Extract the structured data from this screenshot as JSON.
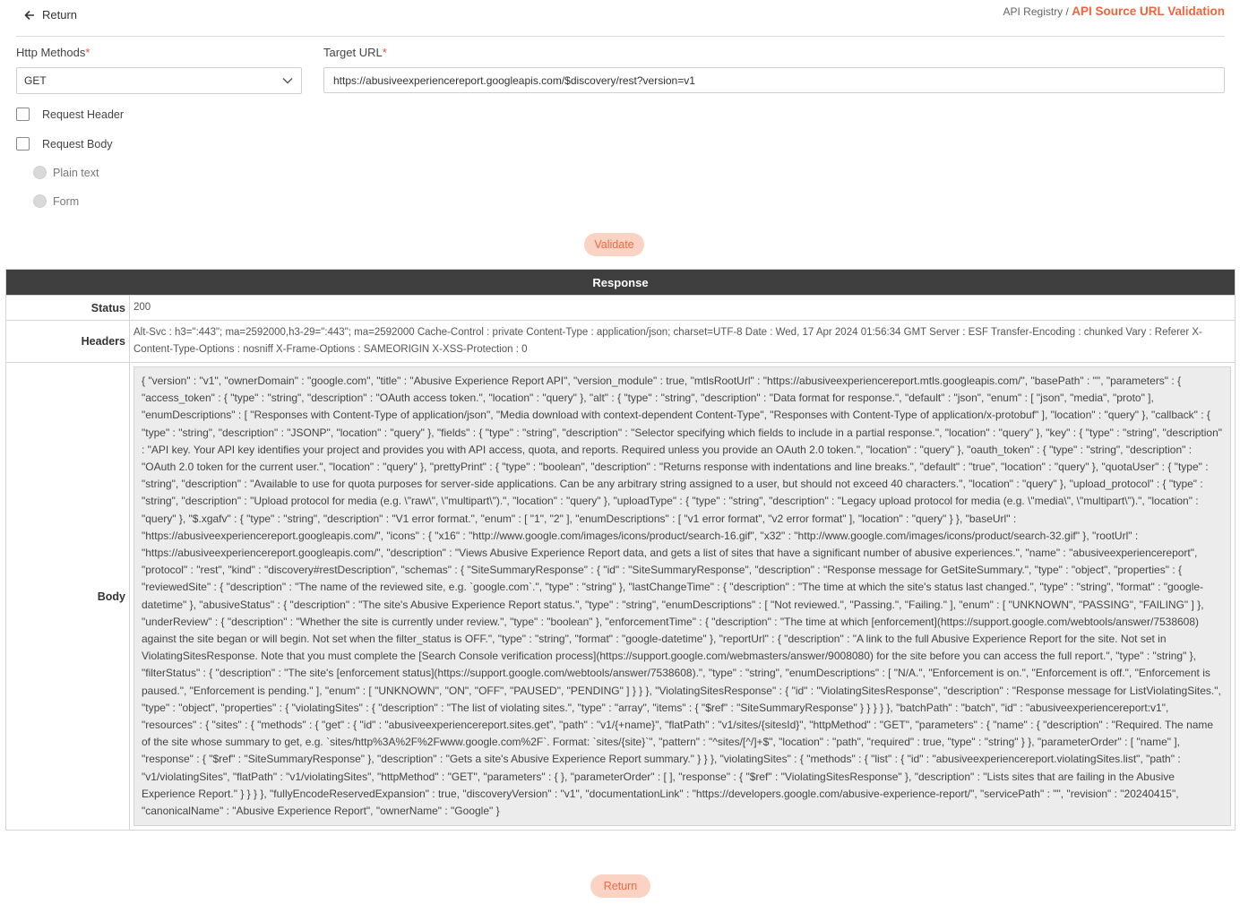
{
  "top": {
    "return_label": "Return",
    "breadcrumb_parent": "API Registry /",
    "breadcrumb_current": "API Source URL Validation"
  },
  "form": {
    "http_methods_label": "Http Methods",
    "http_method_value": "GET",
    "target_url_label": "Target URL",
    "target_url_value": "https://abusiveexperiencereport.googleapis.com/$discovery/rest?version=v1",
    "required_mark": "*",
    "request_header_label": "Request Header",
    "request_body_label": "Request Body",
    "plain_text_label": "Plain text",
    "form_label": "Form"
  },
  "buttons": {
    "validate": "Validate",
    "return": "Return"
  },
  "response": {
    "title": "Response",
    "status_label": "Status",
    "status_value": "200",
    "headers_label": "Headers",
    "headers_value": "Alt-Svc : h3=\":443\"; ma=2592000,h3-29=\":443\"; ma=2592000 Cache-Control : private Content-Type : application/json; charset=UTF-8 Date : Wed, 17 Apr 2024 01:56:34 GMT Server : ESF Transfer-Encoding : chunked Vary : Referer X-Content-Type-Options : nosniff X-Frame-Options : SAMEORIGIN X-XSS-Protection : 0",
    "body_label": "Body",
    "body_value": "{ \"version\" : \"v1\", \"ownerDomain\" : \"google.com\", \"title\" : \"Abusive Experience Report API\", \"version_module\" : true, \"mtlsRootUrl\" : \"https://abusiveexperiencereport.mtls.googleapis.com/\", \"basePath\" : \"\", \"parameters\" : { \"access_token\" : { \"type\" : \"string\", \"description\" : \"OAuth access token.\", \"location\" : \"query\" }, \"alt\" : { \"type\" : \"string\", \"description\" : \"Data format for response.\", \"default\" : \"json\", \"enum\" : [ \"json\", \"media\", \"proto\" ], \"enumDescriptions\" : [ \"Responses with Content-Type of application/json\", \"Media download with context-dependent Content-Type\", \"Responses with Content-Type of application/x-protobuf\" ], \"location\" : \"query\" }, \"callback\" : { \"type\" : \"string\", \"description\" : \"JSONP\", \"location\" : \"query\" }, \"fields\" : { \"type\" : \"string\", \"description\" : \"Selector specifying which fields to include in a partial response.\", \"location\" : \"query\" }, \"key\" : { \"type\" : \"string\", \"description\" : \"API key. Your API key identifies your project and provides you with API access, quota, and reports. Required unless you provide an OAuth 2.0 token.\", \"location\" : \"query\" }, \"oauth_token\" : { \"type\" : \"string\", \"description\" : \"OAuth 2.0 token for the current user.\", \"location\" : \"query\" }, \"prettyPrint\" : { \"type\" : \"boolean\", \"description\" : \"Returns response with indentations and line breaks.\", \"default\" : \"true\", \"location\" : \"query\" }, \"quotaUser\" : { \"type\" : \"string\", \"description\" : \"Available to use for quota purposes for server-side applications. Can be any arbitrary string assigned to a user, but should not exceed 40 characters.\", \"location\" : \"query\" }, \"upload_protocol\" : { \"type\" : \"string\", \"description\" : \"Upload protocol for media (e.g. \\\"raw\\\", \\\"multipart\\\").\", \"location\" : \"query\" }, \"uploadType\" : { \"type\" : \"string\", \"description\" : \"Legacy upload protocol for media (e.g. \\\"media\\\", \\\"multipart\\\").\", \"location\" : \"query\" }, \"$.xgafv\" : { \"type\" : \"string\", \"description\" : \"V1 error format.\", \"enum\" : [ \"1\", \"2\" ], \"enumDescriptions\" : [ \"v1 error format\", \"v2 error format\" ], \"location\" : \"query\" } }, \"baseUrl\" : \"https://abusiveexperiencereport.googleapis.com/\", \"icons\" : { \"x16\" : \"http://www.google.com/images/icons/product/search-16.gif\", \"x32\" : \"http://www.google.com/images/icons/product/search-32.gif\" }, \"rootUrl\" : \"https://abusiveexperiencereport.googleapis.com/\", \"description\" : \"Views Abusive Experience Report data, and gets a list of sites that have a significant number of abusive experiences.\", \"name\" : \"abusiveexperiencereport\", \"protocol\" : \"rest\", \"kind\" : \"discovery#restDescription\", \"schemas\" : { \"SiteSummaryResponse\" : { \"id\" : \"SiteSummaryResponse\", \"description\" : \"Response message for GetSiteSummary.\", \"type\" : \"object\", \"properties\" : { \"reviewedSite\" : { \"description\" : \"The name of the reviewed site, e.g. `google.com`.\", \"type\" : \"string\" }, \"lastChangeTime\" : { \"description\" : \"The time at which the site's status last changed.\", \"type\" : \"string\", \"format\" : \"google-datetime\" }, \"abusiveStatus\" : { \"description\" : \"The site's Abusive Experience Report status.\", \"type\" : \"string\", \"enumDescriptions\" : [ \"Not reviewed.\", \"Passing.\", \"Failing.\" ], \"enum\" : [ \"UNKNOWN\", \"PASSING\", \"FAILING\" ] }, \"underReview\" : { \"description\" : \"Whether the site is currently under review.\", \"type\" : \"boolean\" }, \"enforcementTime\" : { \"description\" : \"The time at which [enforcement](https://support.google.com/webtools/answer/7538608) against the site began or will begin. Not set when the filter_status is OFF.\", \"type\" : \"string\", \"format\" : \"google-datetime\" }, \"reportUrl\" : { \"description\" : \"A link to the full Abusive Experience Report for the site. Not set in ViolatingSitesResponse. Note that you must complete the [Search Console verification process](https://support.google.com/webmasters/answer/9008080) for the site before you can access the full report.\", \"type\" : \"string\" }, \"filterStatus\" : { \"description\" : \"The site's [enforcement status](https://support.google.com/webtools/answer/7538608).\", \"type\" : \"string\", \"enumDescriptions\" : [ \"N/A.\", \"Enforcement is on.\", \"Enforcement is off.\", \"Enforcement is paused.\", \"Enforcement is pending.\" ], \"enum\" : [ \"UNKNOWN\", \"ON\", \"OFF\", \"PAUSED\", \"PENDING\" ] } } }, \"ViolatingSitesResponse\" : { \"id\" : \"ViolatingSitesResponse\", \"description\" : \"Response message for ListViolatingSites.\", \"type\" : \"object\", \"properties\" : { \"violatingSites\" : { \"description\" : \"The list of violating sites.\", \"type\" : \"array\", \"items\" : { \"$ref\" : \"SiteSummaryResponse\" } } } } }, \"batchPath\" : \"batch\", \"id\" : \"abusiveexperiencereport:v1\", \"resources\" : { \"sites\" : { \"methods\" : { \"get\" : { \"id\" : \"abusiveexperiencereport.sites.get\", \"path\" : \"v1/{+name}\", \"flatPath\" : \"v1/sites/{sitesId}\", \"httpMethod\" : \"GET\", \"parameters\" : { \"name\" : { \"description\" : \"Required. The name of the site whose summary to get, e.g. `sites/http%3A%2F%2Fwww.google.com%2F`. Format: `sites/{site}`\", \"pattern\" : \"^sites/[^/]+$\", \"location\" : \"path\", \"required\" : true, \"type\" : \"string\" } }, \"parameterOrder\" : [ \"name\" ], \"response\" : { \"$ref\" : \"SiteSummaryResponse\" }, \"description\" : \"Gets a site's Abusive Experience Report summary.\" } } }, \"violatingSites\" : { \"methods\" : { \"list\" : { \"id\" : \"abusiveexperiencereport.violatingSites.list\", \"path\" : \"v1/violatingSites\", \"flatPath\" : \"v1/violatingSites\", \"httpMethod\" : \"GET\", \"parameters\" : { }, \"parameterOrder\" : [ ], \"response\" : { \"$ref\" : \"ViolatingSitesResponse\" }, \"description\" : \"Lists sites that are failing in the Abusive Experience Report.\" } } } }, \"fullyEncodeReservedExpansion\" : true, \"discoveryVersion\" : \"v1\", \"documentationLink\" : \"https://developers.google.com/abusive-experience-report/\", \"servicePath\" : \"\", \"revision\" : \"20240415\", \"canonicalName\" : \"Abusive Experience Report\", \"ownerName\" : \"Google\" }"
  },
  "icons": {
    "return": "arrow-left-icon",
    "select": "chevron-down-icon"
  },
  "colors": {
    "accent": "#f0643c",
    "button_bg": "#fbd3c4",
    "header_bg": "#3f3f3f"
  }
}
